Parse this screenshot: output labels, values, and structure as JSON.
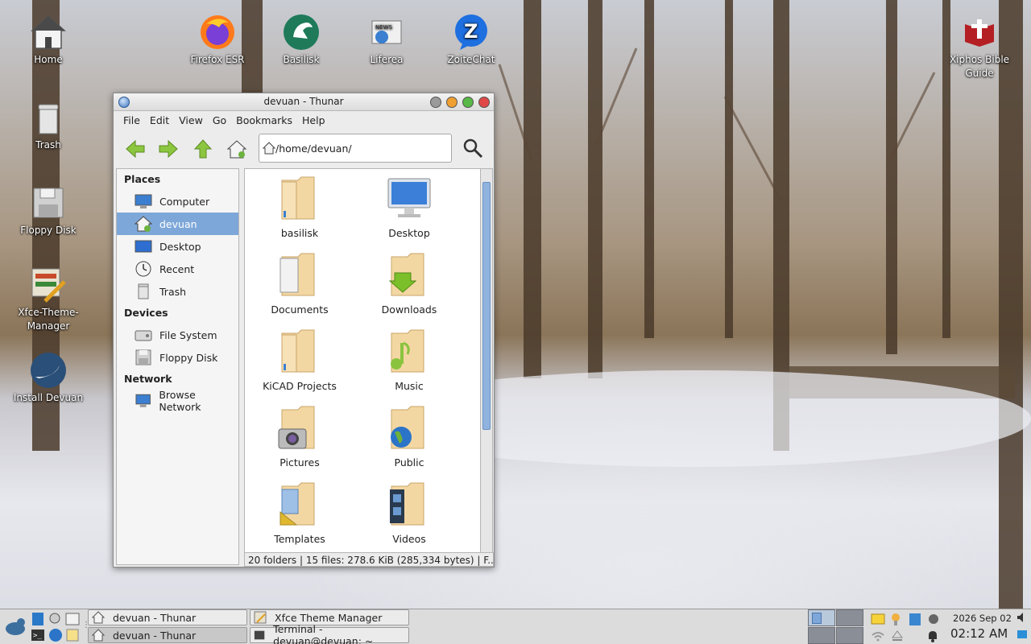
{
  "desktop": {
    "icons": [
      {
        "label": "Home",
        "icon": "home-folder-icon"
      },
      {
        "label": "Firefox ESR",
        "icon": "firefox-icon"
      },
      {
        "label": "Basilisk",
        "icon": "basilisk-icon"
      },
      {
        "label": "Liferea",
        "icon": "liferea-icon"
      },
      {
        "label": "ZoiteChat",
        "icon": "zoitechat-icon"
      },
      {
        "label": "Xiphos Bible Guide",
        "icon": "xiphos-icon"
      },
      {
        "label": "Trash",
        "icon": "trash-icon"
      },
      {
        "label": "Floppy Disk",
        "icon": "floppy-icon"
      },
      {
        "label": "Xfce-Theme-Manager",
        "icon": "theme-manager-icon"
      },
      {
        "label": "Install Devuan",
        "icon": "devuan-installer-icon"
      }
    ]
  },
  "window": {
    "title": "devuan - Thunar",
    "menu": [
      "File",
      "Edit",
      "View",
      "Go",
      "Bookmarks",
      "Help"
    ],
    "address": "/home/devuan/",
    "sidebar": {
      "places_heading": "Places",
      "places": [
        {
          "label": "Computer",
          "icon": "computer-icon"
        },
        {
          "label": "devuan",
          "icon": "home-icon",
          "selected": true
        },
        {
          "label": "Desktop",
          "icon": "desktop-icon"
        },
        {
          "label": "Recent",
          "icon": "recent-icon"
        },
        {
          "label": "Trash",
          "icon": "trash-icon"
        }
      ],
      "devices_heading": "Devices",
      "devices": [
        {
          "label": "File System",
          "icon": "harddisk-icon"
        },
        {
          "label": "Floppy Disk",
          "icon": "floppy-icon"
        }
      ],
      "network_heading": "Network",
      "network": [
        {
          "label": "Browse Network",
          "icon": "network-icon"
        }
      ]
    },
    "files": [
      {
        "name": "basilisk",
        "icon": "folder-icon"
      },
      {
        "name": "Desktop",
        "icon": "desktop-folder-icon"
      },
      {
        "name": "Documents",
        "icon": "documents-folder-icon"
      },
      {
        "name": "Downloads",
        "icon": "downloads-folder-icon"
      },
      {
        "name": "KiCAD Projects",
        "icon": "folder-icon"
      },
      {
        "name": "Music",
        "icon": "music-folder-icon"
      },
      {
        "name": "Pictures",
        "icon": "pictures-folder-icon"
      },
      {
        "name": "Public",
        "icon": "public-folder-icon"
      },
      {
        "name": "Templates",
        "icon": "templates-folder-icon"
      },
      {
        "name": "Videos",
        "icon": "videos-folder-icon"
      }
    ],
    "status": "20 folders  |  15 files: 278.6 KiB (285,334 bytes)  |  F..."
  },
  "panel": {
    "tasks": [
      {
        "label": "devuan - Thunar",
        "active": false
      },
      {
        "label": "Xfce Theme Manager",
        "active": false
      },
      {
        "label": "devuan - Thunar",
        "active": true
      },
      {
        "label": "Terminal - devuan@devuan: ~",
        "active": false
      }
    ],
    "date": "2026 Sep 02",
    "time": "02:12 AM"
  },
  "colors": {
    "selection": "#7ea7d9",
    "close": "#e04848",
    "minimize": "#f0a030",
    "maximize": "#58b848"
  }
}
